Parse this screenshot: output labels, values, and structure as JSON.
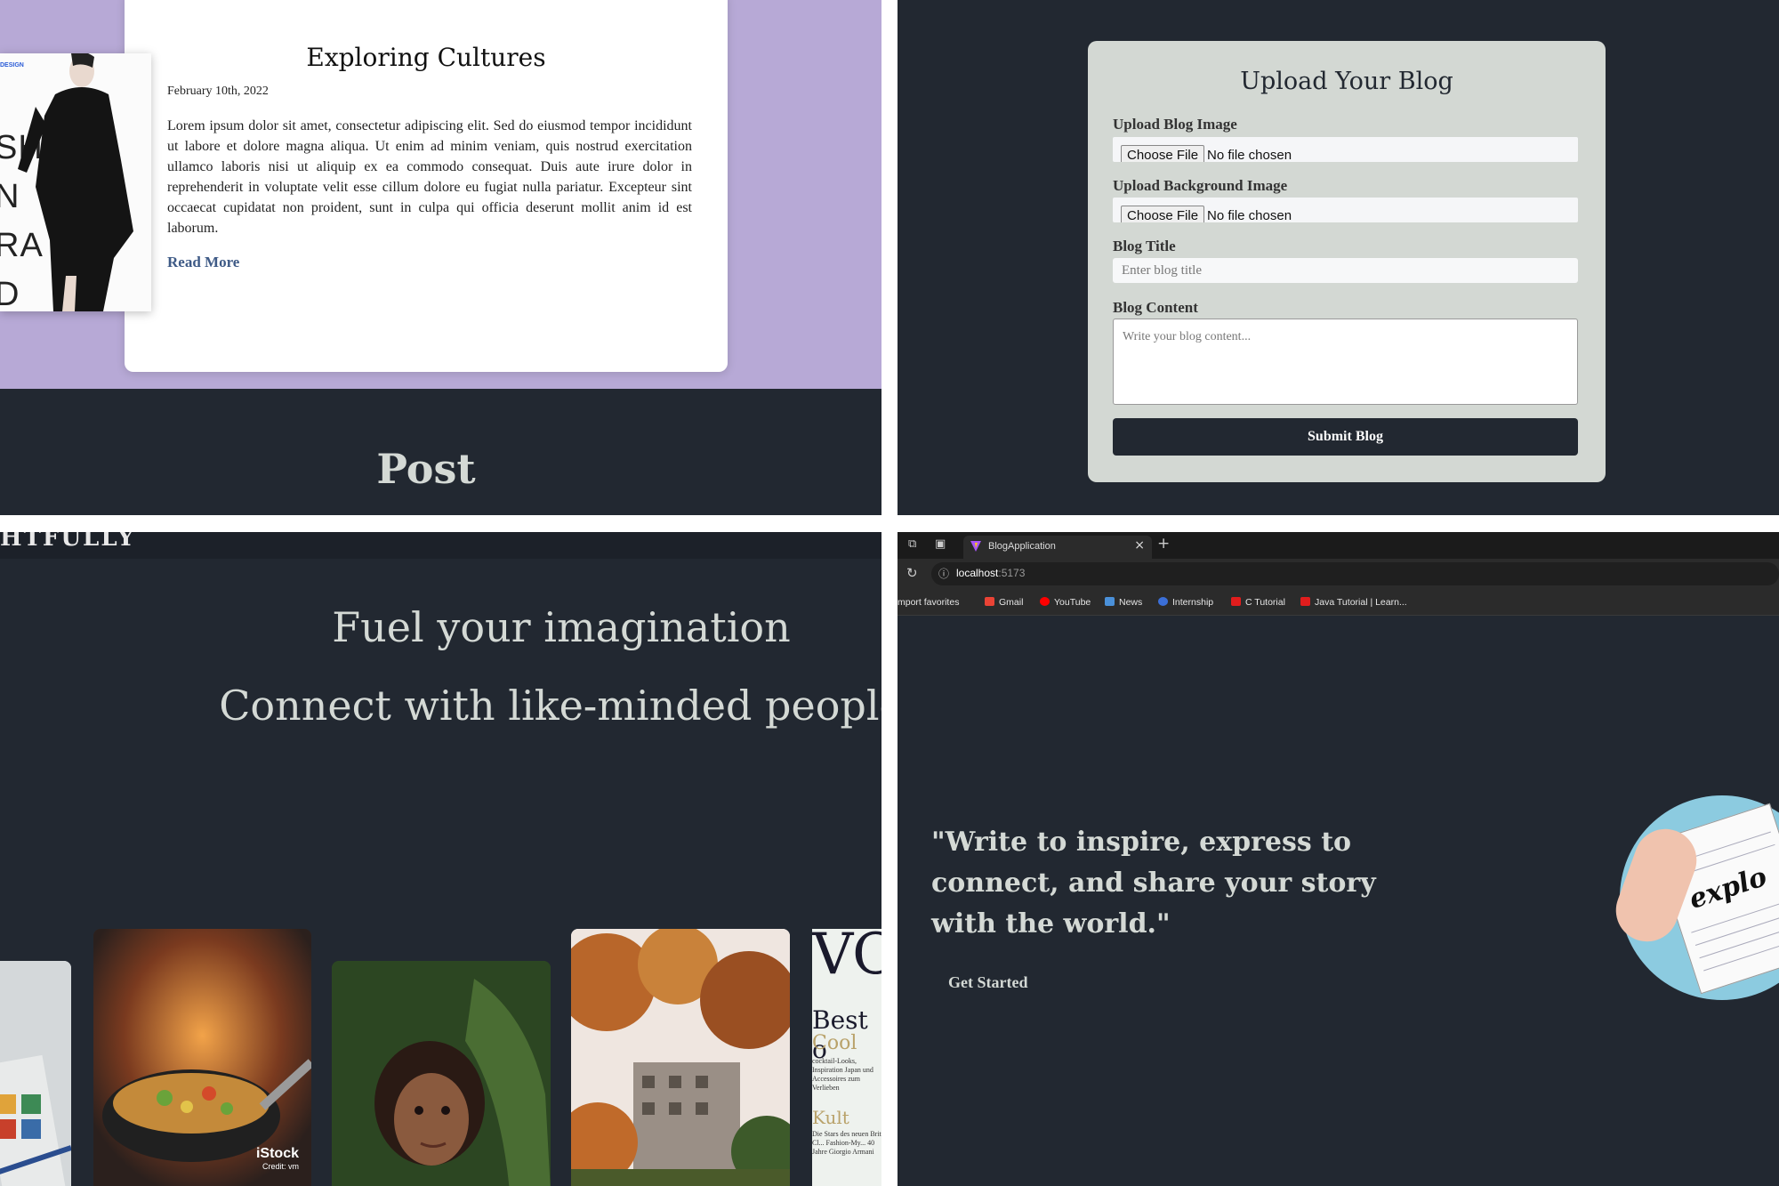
{
  "blog_card": {
    "title": "Exploring Cultures",
    "date": "February 10th, 2022",
    "body": "Lorem ipsum dolor sit amet, consectetur adipiscing elit. Sed do eiusmod tempor incididunt ut labore et dolore magna aliqua. Ut enim ad minim veniam, quis nostrud exercitation ullamco laboris nisi ut aliquip ex ea commodo consequat. Duis aute irure dolor in reprehenderit in voluptate velit esse cillum dolore eu fugiat nulla pariatur. Excepteur sint occaecat cupidatat non proident, sunt in culpa qui officia deserunt mollit anim id est laborum.",
    "read_more": "Read More",
    "image_brand": "DESIGN",
    "image_letters": [
      "SH",
      "N",
      "RA",
      "D"
    ]
  },
  "post_section": {
    "heading": "Post"
  },
  "upload_form": {
    "title": "Upload Your Blog",
    "image_label": "Upload Blog Image",
    "background_label": "Upload Background Image",
    "choose_file": "Choose File",
    "no_file": "No file chosen",
    "title_label": "Blog Title",
    "title_placeholder": "Enter blog title",
    "content_label": "Blog Content",
    "content_placeholder": "Write your blog content...",
    "submit": "Submit Blog"
  },
  "landing": {
    "header_fragment": "HTFULLY",
    "tagline_1": "Fuel your imagination",
    "tagline_2": "Connect with like-minded people",
    "istock": "iStock",
    "istock_credit": "Credit: vm",
    "magazine": {
      "masthead": "VO",
      "best": "Best o",
      "cool": "Cool",
      "blurb": "cocktail-Looks, Inspiration Japan und Accessoires zum Verlieben",
      "kult": "Kult",
      "blurb2": "Die Stars des neuen Brit Cl... Fashion-My... 40 Jahre Giorgio Armani"
    }
  },
  "browser": {
    "tab_title": "BlogApplication",
    "url_host": "localhost",
    "url_port": ":5173",
    "bookmarks": [
      "mport favorites",
      "Gmail",
      "YouTube",
      "News",
      "Internship",
      "C Tutorial",
      "Java Tutorial | Learn..."
    ],
    "icons": [
      "workspaces-icon",
      "tab-actions-icon",
      "close-icon",
      "new-tab-icon",
      "refresh-icon",
      "info-icon"
    ]
  },
  "hero": {
    "quote": "\"Write to inspire, express to connect, and share your story with the world.\"",
    "cta": "Get Started",
    "illustration_text": "explo"
  },
  "colors": {
    "dark": "#222831",
    "lavender": "#b7a9d6",
    "form_bg": "#d3d8d3",
    "light_text": "#d4d9d5",
    "link": "#3e5a86"
  }
}
